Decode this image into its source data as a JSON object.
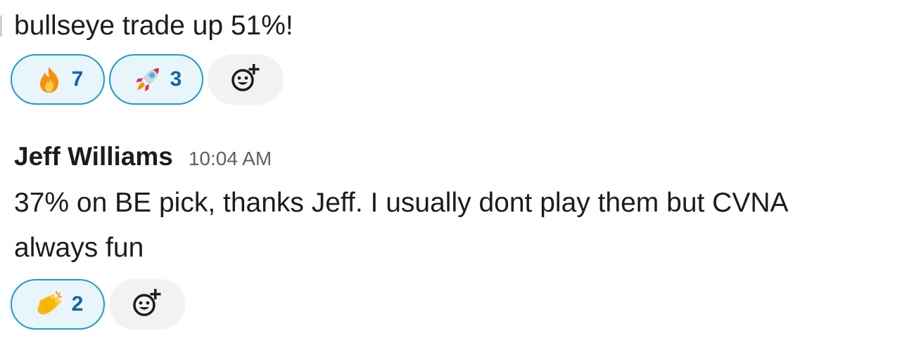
{
  "message_1": {
    "text": "bullseye trade up 51%!",
    "reactions": [
      {
        "icon": "fire-icon",
        "count": "7"
      },
      {
        "icon": "rocket-icon",
        "count": "3"
      }
    ]
  },
  "message_2": {
    "sender": "Jeff Williams",
    "time": "10:04 AM",
    "text_line_1": "37% on BE pick, thanks Jeff. I usually dont play them but CVNA",
    "text_line_2": "always fun",
    "reactions": [
      {
        "icon": "clapping-hands-icon",
        "count": "2"
      }
    ]
  },
  "colors": {
    "reaction_border": "#1d9bd1",
    "reaction_bg": "#e8f5fa",
    "reaction_count": "#1264a3",
    "add_reaction_bg": "#f2f2f2",
    "text": "#1d1c1d",
    "timestamp": "#616061"
  },
  "icons": {
    "add_reaction": "add-emoji-reaction-icon"
  }
}
